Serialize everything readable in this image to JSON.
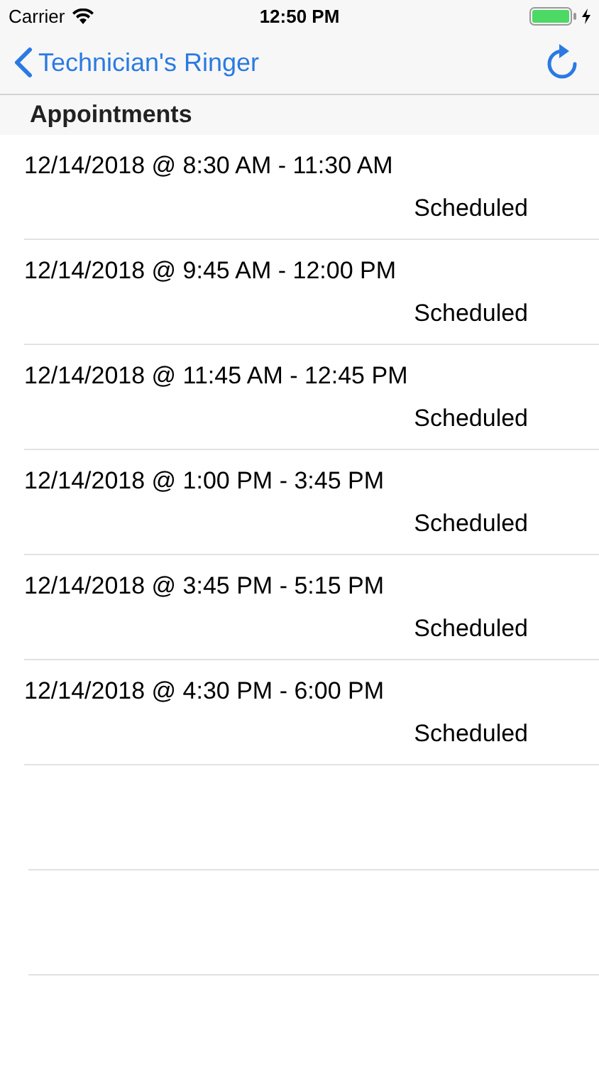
{
  "status_bar": {
    "carrier": "Carrier",
    "time": "12:50 PM"
  },
  "nav_bar": {
    "back_label": "Technician's Ringer"
  },
  "section": {
    "title": "Appointments"
  },
  "appointments": [
    {
      "time": "12/14/2018 @ 8:30 AM - 11:30 AM",
      "status": "Scheduled"
    },
    {
      "time": "12/14/2018 @ 9:45 AM - 12:00 PM",
      "status": "Scheduled"
    },
    {
      "time": "12/14/2018 @ 11:45 AM - 12:45 PM",
      "status": "Scheduled"
    },
    {
      "time": "12/14/2018 @ 1:00 PM - 3:45 PM",
      "status": "Scheduled"
    },
    {
      "time": "12/14/2018 @ 3:45 PM - 5:15 PM",
      "status": "Scheduled"
    },
    {
      "time": "12/14/2018 @ 4:30 PM - 6:00 PM",
      "status": "Scheduled"
    }
  ]
}
